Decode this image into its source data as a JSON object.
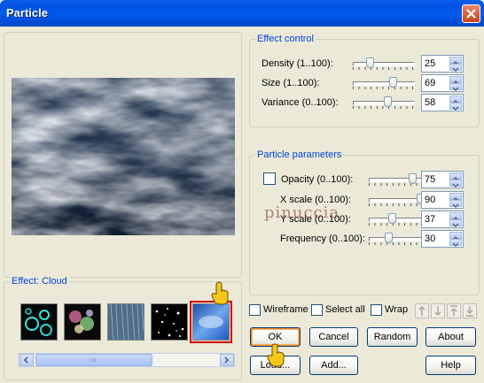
{
  "window": {
    "title": "Particle"
  },
  "colors": {
    "titlebar": "#0053e1",
    "legend": "#0046d5",
    "selected_outline": "#d20000",
    "face": "#ece9d8"
  },
  "effect_control": {
    "legend": "Effect control",
    "rows": [
      {
        "label": "Density (1..100):",
        "value": "25",
        "fraction": 0.25
      },
      {
        "label": "Size (1..100):",
        "value": "69",
        "fraction": 0.69
      },
      {
        "label": "Variance (0..100):",
        "value": "58",
        "fraction": 0.58
      }
    ]
  },
  "particle_parameters": {
    "legend": "Particle parameters",
    "rows": [
      {
        "label": "Opacity (0..100):",
        "value": "75",
        "fraction": 0.75,
        "checkbox": true
      },
      {
        "label": "X scale (0..100):",
        "value": "90",
        "fraction": 0.9
      },
      {
        "label": "Y scale (0..100):",
        "value": "37",
        "fraction": 0.37
      },
      {
        "label": "Frequency (0..100):",
        "value": "30",
        "fraction": 0.3
      }
    ]
  },
  "effect_pane": {
    "legend": "Effect: Cloud",
    "thumbnails": [
      "bubbles",
      "sparkles",
      "rain",
      "stars",
      "cloud"
    ],
    "selected": "cloud",
    "scroll_fraction": 0.55
  },
  "options": {
    "wireframe": "Wireframe",
    "select_all": "Select all",
    "wrap": "Wrap"
  },
  "buttons": {
    "ok": "OK",
    "cancel": "Cancel",
    "random": "Random",
    "about": "About",
    "load": "Load...",
    "add": "Add...",
    "help": "Help"
  },
  "icon_buttons": [
    "arrow-up-icon",
    "arrow-down-icon",
    "arrow-top-icon",
    "arrow-bottom-icon"
  ],
  "watermark": "pinuccia"
}
